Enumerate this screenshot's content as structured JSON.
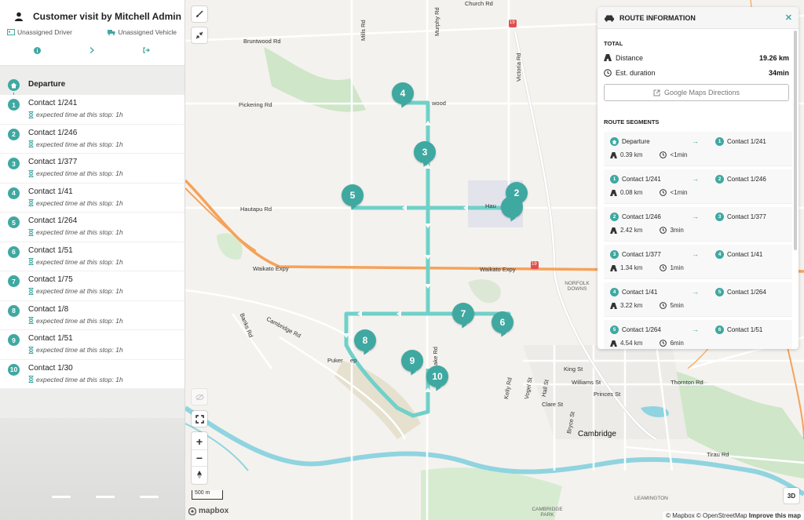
{
  "header": {
    "title": "Customer visit by Mitchell Admin",
    "driver": "Unassigned Driver",
    "vehicle": "Unassigned Vehicle"
  },
  "stops": [
    {
      "badge": "",
      "label": "Departure",
      "sub": ""
    },
    {
      "badge": "1",
      "label": "Contact 1/241",
      "sub": "expected time at this stop: 1h"
    },
    {
      "badge": "2",
      "label": "Contact 1/246",
      "sub": "expected time at this stop: 1h"
    },
    {
      "badge": "3",
      "label": "Contact 1/377",
      "sub": "expected time at this stop: 1h"
    },
    {
      "badge": "4",
      "label": "Contact 1/41",
      "sub": "expected time at this stop: 1h"
    },
    {
      "badge": "5",
      "label": "Contact 1/264",
      "sub": "expected time at this stop: 1h"
    },
    {
      "badge": "6",
      "label": "Contact 1/51",
      "sub": "expected time at this stop: 1h"
    },
    {
      "badge": "7",
      "label": "Contact 1/75",
      "sub": "expected time at this stop: 1h"
    },
    {
      "badge": "8",
      "label": "Contact 1/8",
      "sub": "expected time at this stop: 1h"
    },
    {
      "badge": "9",
      "label": "Contact 1/51",
      "sub": "expected time at this stop: 1h"
    },
    {
      "badge": "10",
      "label": "Contact 1/30",
      "sub": "expected time at this stop: 1h"
    }
  ],
  "map": {
    "labels": {
      "brunt": "Bruntwood Rd",
      "pickering": "Pickering Rd",
      "hautapu": "Hautapu Rd",
      "waikato1": "Waikato Expy",
      "waikato2": "Waikato Expy",
      "cambridge_rd": "Cambridge Rd",
      "banks": "Banks Rd",
      "mills": "Mills Rd",
      "murphy": "Murphy Rd",
      "victoria": "Victoria Rd",
      "church": "Church Rd",
      "wood": "wood",
      "hau": "Hau",
      "pukerimu": "Puker",
      "kep": "ep",
      "lake": "Lake Rd",
      "king": "King St",
      "williams": "Williams St",
      "princes": "Princes St",
      "thornton": "Thornton Rd",
      "clare": "Clare St",
      "kelly": "Kelly Rd",
      "vogel": "Vogel St",
      "hall": "Hall St",
      "bryce": "Bryce St",
      "tirau": "Tirau Rd",
      "cambridge": "Cambridge",
      "norfolk": "NORFOLK DOWNS",
      "park": "CAMBRIDGE PARK",
      "leamington": "LEAMINGTON"
    },
    "markers": [
      "2",
      "3",
      "4",
      "5",
      "6",
      "7",
      "8",
      "9",
      "10"
    ],
    "scale": "500 m",
    "logo": "mapbox",
    "attribution_a": "© Mapbox © OpenStreetMap",
    "attribution_b": "Improve this map",
    "btn_3d": "3D",
    "shields": [
      "19",
      "19"
    ]
  },
  "route_panel": {
    "title": "ROUTE INFORMATION",
    "total_label": "TOTAL",
    "distance_label": "Distance",
    "distance_value": "19.26 km",
    "duration_label": "Est. duration",
    "duration_value": "34min",
    "gmaps_label": "Google Maps Directions",
    "segments_label": "ROUTE SEGMENTS",
    "segments": [
      {
        "from_badge": "",
        "from": "Departure",
        "to_badge": "1",
        "to": "Contact 1/241",
        "km": "0.39 km",
        "min": "<1min"
      },
      {
        "from_badge": "1",
        "from": "Contact 1/241",
        "to_badge": "2",
        "to": "Contact 1/246",
        "km": "0.08 km",
        "min": "<1min"
      },
      {
        "from_badge": "2",
        "from": "Contact 1/246",
        "to_badge": "3",
        "to": "Contact 1/377",
        "km": "2.42 km",
        "min": "3min"
      },
      {
        "from_badge": "3",
        "from": "Contact 1/377",
        "to_badge": "4",
        "to": "Contact 1/41",
        "km": "1.34 km",
        "min": "1min"
      },
      {
        "from_badge": "4",
        "from": "Contact 1/41",
        "to_badge": "5",
        "to": "Contact 1/264",
        "km": "3.22 km",
        "min": "5min"
      },
      {
        "from_badge": "5",
        "from": "Contact 1/264",
        "to_badge": "6",
        "to": "Contact 1/51",
        "km": "4.54 km",
        "min": "6min"
      }
    ]
  },
  "colors": {
    "accent": "#3fa8a1",
    "route": "#6fd1c9",
    "highway": "#f5a25a"
  }
}
